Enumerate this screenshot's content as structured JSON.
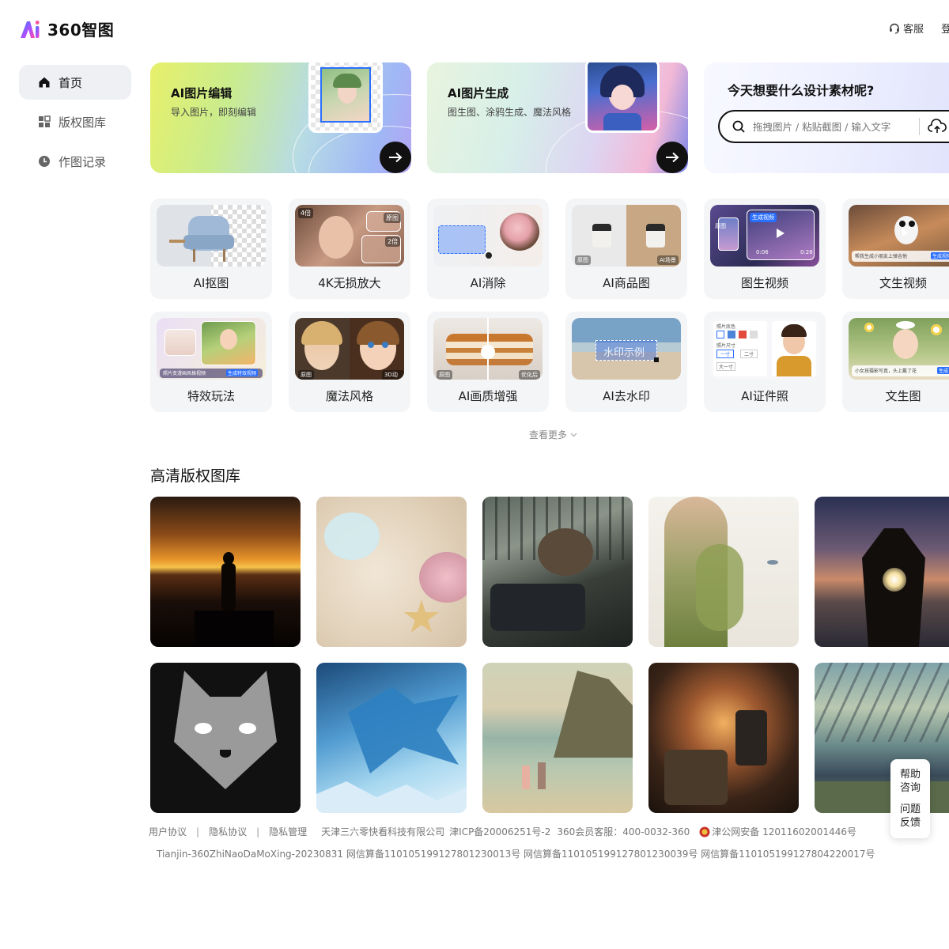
{
  "header": {
    "logo_text": "360智图",
    "customer_service": "客服",
    "login": "登录"
  },
  "sidebar": {
    "items": [
      {
        "label": "首页",
        "icon": "home-icon",
        "active": true
      },
      {
        "label": "版权图库",
        "icon": "grid-icon",
        "active": false
      },
      {
        "label": "作图记录",
        "icon": "clock-icon",
        "active": false
      }
    ]
  },
  "banners": [
    {
      "title": "AI图片编辑",
      "subtitle": "导入图片，即刻编辑"
    },
    {
      "title": "AI图片生成",
      "subtitle": "图生图、涂鸦生成、魔法风格"
    },
    {
      "title": "今天想要什么设计素材呢?",
      "search_placeholder": "拖拽图片 / 粘贴截图 / 输入文字"
    }
  ],
  "tools": [
    {
      "label": "AI抠图"
    },
    {
      "label": "4K无损放大",
      "tags": [
        "4倍",
        "原图",
        "2倍"
      ]
    },
    {
      "label": "AI消除"
    },
    {
      "label": "AI商品图",
      "tags": [
        "原图",
        "AI场景"
      ]
    },
    {
      "label": "图生视频",
      "tags": [
        "原图",
        "生成视频",
        "0:06",
        "0:26"
      ]
    },
    {
      "label": "文生视频",
      "tags": [
        "帮我生成小朋友上弹吉他",
        "生成视频"
      ]
    },
    {
      "label": "特效玩法",
      "tags": [
        "照片变漫画风格视频",
        "生成特效视频"
      ]
    },
    {
      "label": "魔法风格",
      "tags": [
        "原图",
        "3D动漫"
      ]
    },
    {
      "label": "AI画质增强",
      "tags": [
        "原图",
        "优化后"
      ]
    },
    {
      "label": "AI去水印",
      "watermark_text": "水印示例"
    },
    {
      "label": "AI证件照",
      "tags": [
        "照片底色",
        "照片尺寸",
        "一寸",
        "二寸",
        "大一寸"
      ]
    },
    {
      "label": "文生图",
      "tags": [
        "小女孩摄影写真，头上戴了花",
        "生成"
      ]
    }
  ],
  "see_more": "查看更多",
  "gallery": {
    "title": "高清版权图库",
    "photos": [
      "sunset-silhouette",
      "seashells-sand",
      "steampunk-train",
      "nature-woman",
      "lighthouse-sunset",
      "cat-illustration",
      "ice-dragon",
      "impressionist-coast",
      "robot-battle",
      "impressionist-station"
    ]
  },
  "float_help": {
    "help": "帮助咨询",
    "feedback": "问题反馈"
  },
  "footer": {
    "user_agreement": "用户协议",
    "privacy_agreement": "隐私协议",
    "privacy_management": "隐私管理",
    "company": "天津三六零快看科技有限公司",
    "icp": "津ICP备20006251号-2",
    "hotline": "360会员客服：400-0032-360",
    "police": "津公网安备 12011602001446号",
    "line2": "Tianjin-360ZhiNaoDaMoXing-20230831 网信算备110105199127801230013号 网信算备110105199127801230039号 网信算备110105199127804220017号"
  },
  "colors": {
    "accent": "#111111",
    "active_bg": "#eef0f4",
    "card_bg": "#f4f5f7"
  }
}
